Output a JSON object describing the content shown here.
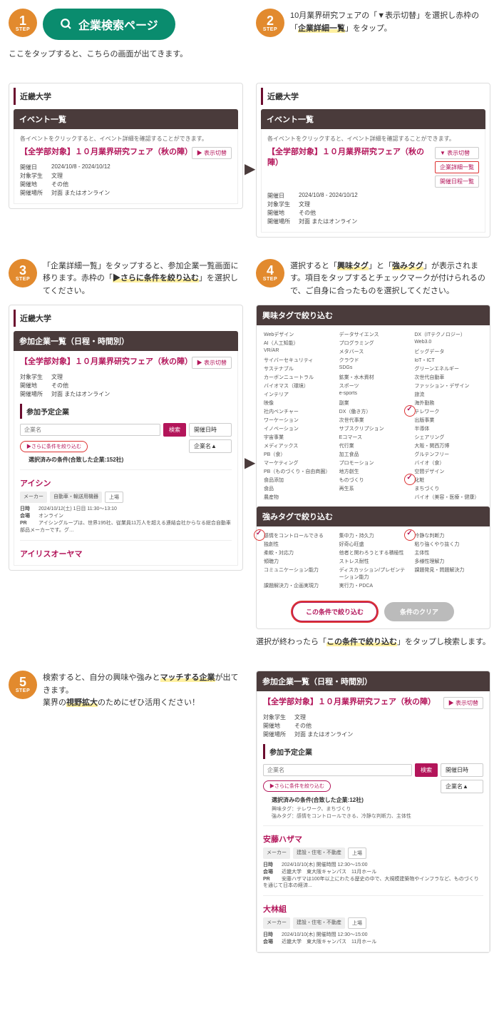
{
  "steps": {
    "s1": {
      "num": "1",
      "label": "STEP",
      "pill": "企業検索ページ",
      "below": "ここをタップすると、こちらの画面が出てきます。"
    },
    "s2": {
      "num": "2",
      "label": "STEP",
      "text_a": "10月業界研究フェアの「▼表示切替」を選択し赤枠の「",
      "hl": "企業詳細一覧",
      "text_b": "」をタップ。"
    },
    "s3": {
      "num": "3",
      "label": "STEP",
      "text_a": "「企業詳細一覧」をタップすると、参加企業一覧画面に移ります。赤枠の「",
      "hl": "▶さらに条件を絞り込む",
      "text_b": "」を選択してください。"
    },
    "s4": {
      "num": "4",
      "label": "STEP",
      "text_a": "選択すると「",
      "hl1": "興味タグ",
      "text_b": "」と「",
      "hl2": "強みタグ",
      "text_c": "」が表示されます。項目をタップするとチェックマークが付けられるので、ご自身に合ったものを選択してください。",
      "after_a": "選択が終わったら「",
      "after_hl": "この条件で絞り込む",
      "after_b": "」をタップし検索します。"
    },
    "s5": {
      "num": "5",
      "label": "STEP",
      "text_a": "検索すると、自分の興味や強みと",
      "hl1": "マッチする企業",
      "text_b": "が出てきます。",
      "line2a": "業界の",
      "hl2": "視野拡大",
      "line2b": "のためにぜひ活用ください！"
    }
  },
  "university": "近畿大学",
  "eventList": {
    "header": "イベント一覧",
    "note": "各イベントをクリックすると、イベント詳細を確認することができます。"
  },
  "event": {
    "title": "【全学部対象】１０月業界研究フェア（秋の陣）",
    "toggle": "▶ 表示切替",
    "toggle2": "▼ 表示切替",
    "detailList": "企業詳細一覧",
    "dateList": "開催日程一覧",
    "rows": {
      "date_k": "開催日",
      "date_v": "2024/10/8 - 2024/10/12",
      "target_k": "対象学生",
      "target_v": "文理",
      "region_k": "開催地",
      "region_v": "その他",
      "place_k": "開催場所",
      "place_v": "対面 またはオンライン"
    }
  },
  "participants": {
    "header": "参加企業一覧（日程・時間別）",
    "section": "参加予定企業",
    "placeholder": "企業名",
    "searchBtn": "検索",
    "sort1": "開催日時",
    "sort2": "企業名▲",
    "filter": "▶さらに条件を絞り込む",
    "result1": "選択済みの条件(合致した企業:152社)",
    "result2": "選択済みの条件(合致した企業:12社)",
    "tagsNote1": "興味タグ：テレワーク、まちづくり",
    "tagsNote2": "強みタグ：感情をコントロールできる、冷静な判断力、主体性"
  },
  "companies": {
    "c1": {
      "name": "アイシン",
      "tags": [
        "メーカー",
        "自動車・輸送用機器",
        "上場"
      ],
      "rows": {
        "date": "2024/10/12(土) 1日目 11:30〜13:10",
        "place": "オンライン",
        "pr": "アイシングループは、世界195社、従業員11万人を超える連結会社からなる総合自動車部品メーカーです。グ…"
      }
    },
    "c2": {
      "name": "アイリスオーヤマ"
    },
    "c3": {
      "name": "安藤ハザマ",
      "tags": [
        "メーカー",
        "建設・住宅・不動産",
        "上場"
      ],
      "rows": {
        "date": "2024/10/10(木) 開催時間 12:30〜15:00",
        "place": "近畿大学　東大阪キャンパス　11月ホール",
        "pr": "安藤ハザマは100年以上にわたる歴史の中で、大規模建築物やインフラなど、ものづくりを通じて日本の経済..."
      }
    },
    "c4": {
      "name": "大林組",
      "tags": [
        "メーカー",
        "建設・住宅・不動産",
        "上場"
      ],
      "rows": {
        "date": "2024/10/10(木) 開催時間 12:30〜15:00",
        "place": "近畿大学　東大阪キャンパス　11月ホール"
      }
    }
  },
  "interest": {
    "header": "興味タグで絞り込む",
    "items": [
      "Webデザイン",
      "データサイエンス",
      "DX（ITテクノロジー）",
      "AI（人工知能）",
      "プログラミング",
      "Web3.0",
      "VR/AR",
      "メタバース",
      "ビッグデータ",
      "サイバーセキュリティ",
      "クラウド",
      "IoT・ICT",
      "サステナブル",
      "SDGs",
      "グリーンエネルギー",
      "カーボンニュートラル",
      "鉱業・水木資材",
      "次世代自動車",
      "バイオマス（環境）",
      "スポーツ",
      "ファッション・デザイン",
      "インテリア",
      "e-sports",
      "旅流",
      "映像",
      "副業",
      "海外勤務",
      "社内ベンチャー",
      "DX（働き方）",
      "テレワーク",
      "ワーケーション",
      "次世代事業",
      "出版事業",
      "イノベーション",
      "サブスクリプション",
      "半導体",
      "宇宙事業",
      "Eコマース",
      "シェアリング",
      "メディアックス",
      "代行業",
      "大阪・関西万博",
      "PB（食）",
      "加工食品",
      "グルテンフリー",
      "マーケティング",
      "プロモーション",
      "バイオ（食）",
      "PB（ものづくり・自由商圏）",
      "地方創生",
      "空間デザイン",
      "食品添加",
      "ものづくり",
      "化粧",
      "食品",
      "再生系",
      "まちづくり",
      "農産物",
      "",
      "バイオ（美容・医療・健康）"
    ]
  },
  "strength": {
    "header": "強みタグで絞り込む",
    "items": [
      "感情をコントロールできる",
      "集中力・持久力",
      "冷静な判断力",
      "独創性",
      "好奇心旺盛",
      "粘り強くやり抜く力",
      "柔軟・対応力",
      "他者と関わろうとする積極性",
      "主体性",
      "傾聴力",
      "ストレス耐性",
      "多様性理解力",
      "コミュニケーション能力",
      "ディスカッション/プレゼンテーション能力",
      "課題発見・問題解決力",
      "課題解決力・企画実現力",
      "実行力・PDCA",
      ""
    ]
  },
  "actions": {
    "apply": "この条件で絞り込む",
    "clear": "条件のクリア"
  },
  "labels": {
    "date": "日時",
    "place": "会場",
    "pr": "PR"
  }
}
